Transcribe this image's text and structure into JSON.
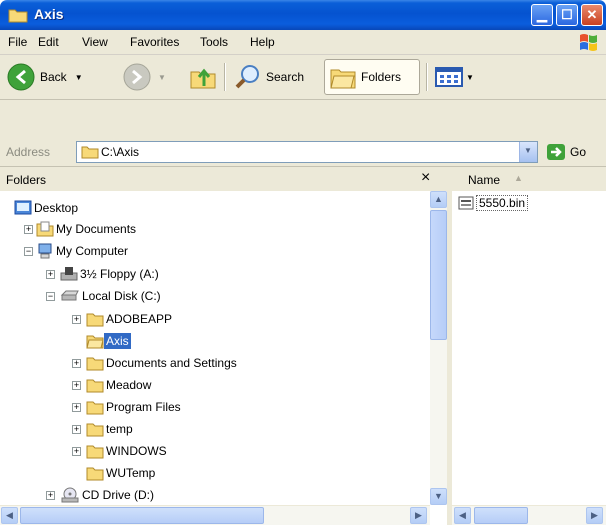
{
  "window": {
    "title": "Axis"
  },
  "menu": {
    "file": "File",
    "edit": "Edit",
    "view": "View",
    "favorites": "Favorites",
    "tools": "Tools",
    "help": "Help"
  },
  "toolbar": {
    "back": "Back",
    "search": "Search",
    "folders": "Folders"
  },
  "address": {
    "label": "Address",
    "value": "C:\\Axis",
    "go": "Go"
  },
  "folders_pane": {
    "title": "Folders",
    "close": "×",
    "items": [
      {
        "label": "Desktop"
      },
      {
        "label": "My Documents"
      },
      {
        "label": "My Computer"
      },
      {
        "label": "3½ Floppy (A:)"
      },
      {
        "label": "Local Disk (C:)"
      },
      {
        "label": "ADOBEAPP"
      },
      {
        "label": "Axis"
      },
      {
        "label": "Documents and Settings"
      },
      {
        "label": "Meadow"
      },
      {
        "label": "Program Files"
      },
      {
        "label": "temp"
      },
      {
        "label": "WINDOWS"
      },
      {
        "label": "WUTemp"
      },
      {
        "label": "CD Drive (D:)"
      }
    ]
  },
  "files_pane": {
    "column_name": "Name",
    "files": [
      {
        "label": "5550.bin"
      }
    ]
  },
  "colors": {
    "selection": "#316ac5",
    "chrome": "#ece9d8",
    "titlebar": "#0553d0"
  }
}
